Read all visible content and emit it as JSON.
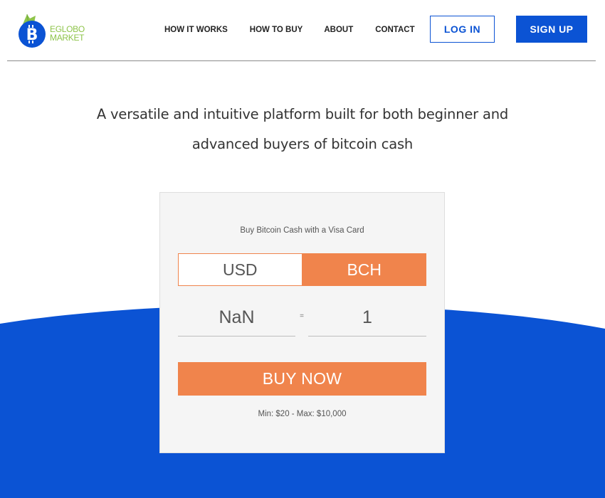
{
  "brand": {
    "line1": "EGLOBO",
    "line2": "MARKET",
    "logo_icon": "bitcoin-b-icon",
    "colors": {
      "blue": "#0b53d4",
      "green": "#8ec44a"
    }
  },
  "nav": {
    "items": [
      {
        "label": "HOW IT WORKS"
      },
      {
        "label": "HOW TO BUY"
      },
      {
        "label": "ABOUT"
      },
      {
        "label": "CONTACT"
      }
    ],
    "login_label": "LOG IN",
    "signup_label": "SIGN UP"
  },
  "hero": {
    "line1": "A versatile and intuitive platform built for both beginner and",
    "line2": "advanced buyers of bitcoin cash"
  },
  "widget": {
    "title": "Buy Bitcoin Cash with a Visa Card",
    "currency_options": [
      "USD",
      "BCH"
    ],
    "selected_currency": "BCH",
    "fiat_amount": "NaN",
    "equals_sign": "=",
    "crypto_amount": "1",
    "buy_label": "BUY NOW",
    "limits": "Min: $20 - Max: $10,000",
    "colors": {
      "accent": "#f0844c",
      "background": "#f5f5f5"
    }
  }
}
